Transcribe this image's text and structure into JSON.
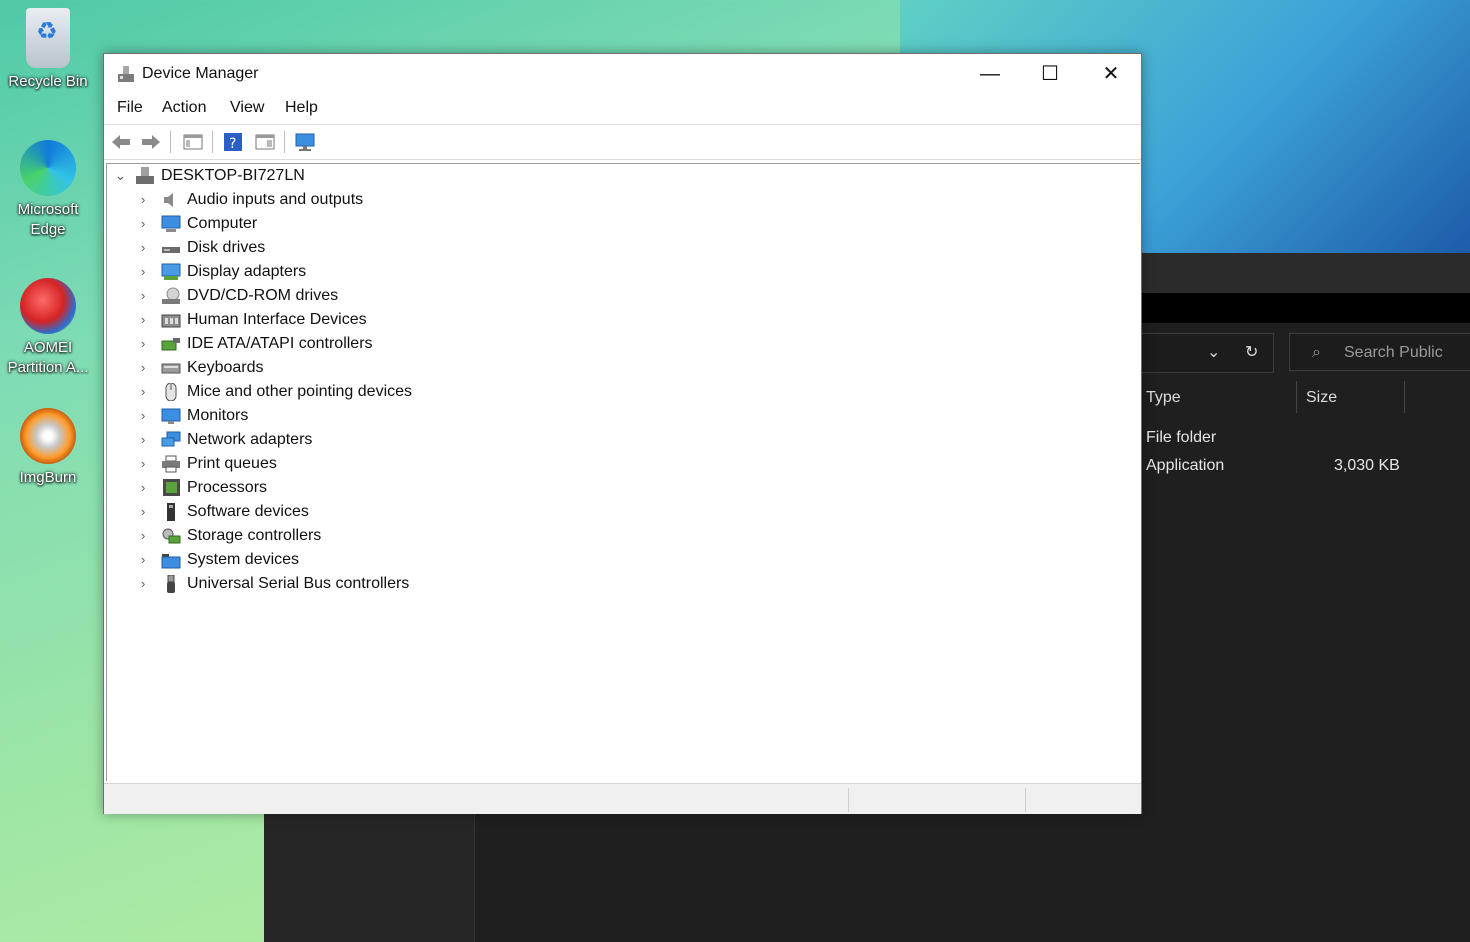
{
  "desktop": {
    "icons": [
      {
        "label": "Recycle Bin"
      },
      {
        "label": "Microsoft Edge"
      },
      {
        "label": "AOMEI Partition A..."
      },
      {
        "label": "ImgBurn"
      }
    ]
  },
  "explorer": {
    "search_placeholder": "Search Public",
    "columns": [
      "Type",
      "Size"
    ],
    "rows": [
      {
        "type": "File folder",
        "size": ""
      },
      {
        "type": "Application",
        "size": "3,030 KB"
      }
    ]
  },
  "window": {
    "title": "Device Manager",
    "menu": [
      "File",
      "Action",
      "View",
      "Help"
    ],
    "tree": {
      "root": "DESKTOP-BI727LN",
      "items": [
        {
          "label": "Audio inputs and outputs",
          "icon": "speaker-icon"
        },
        {
          "label": "Computer",
          "icon": "computer-icon"
        },
        {
          "label": "Disk drives",
          "icon": "disk-drive-icon"
        },
        {
          "label": "Display adapters",
          "icon": "display-adapter-icon"
        },
        {
          "label": "DVD/CD-ROM drives",
          "icon": "dvd-drive-icon"
        },
        {
          "label": "Human Interface Devices",
          "icon": "hid-icon"
        },
        {
          "label": "IDE ATA/ATAPI controllers",
          "icon": "ide-controller-icon"
        },
        {
          "label": "Keyboards",
          "icon": "keyboard-icon"
        },
        {
          "label": "Mice and other pointing devices",
          "icon": "mouse-icon"
        },
        {
          "label": "Monitors",
          "icon": "monitor-icon"
        },
        {
          "label": "Network adapters",
          "icon": "network-adapter-icon"
        },
        {
          "label": "Print queues",
          "icon": "printer-icon"
        },
        {
          "label": "Processors",
          "icon": "processor-icon"
        },
        {
          "label": "Software devices",
          "icon": "software-device-icon"
        },
        {
          "label": "Storage controllers",
          "icon": "storage-controller-icon"
        },
        {
          "label": "System devices",
          "icon": "system-devices-icon"
        },
        {
          "label": "Universal Serial Bus controllers",
          "icon": "usb-icon"
        }
      ]
    }
  }
}
